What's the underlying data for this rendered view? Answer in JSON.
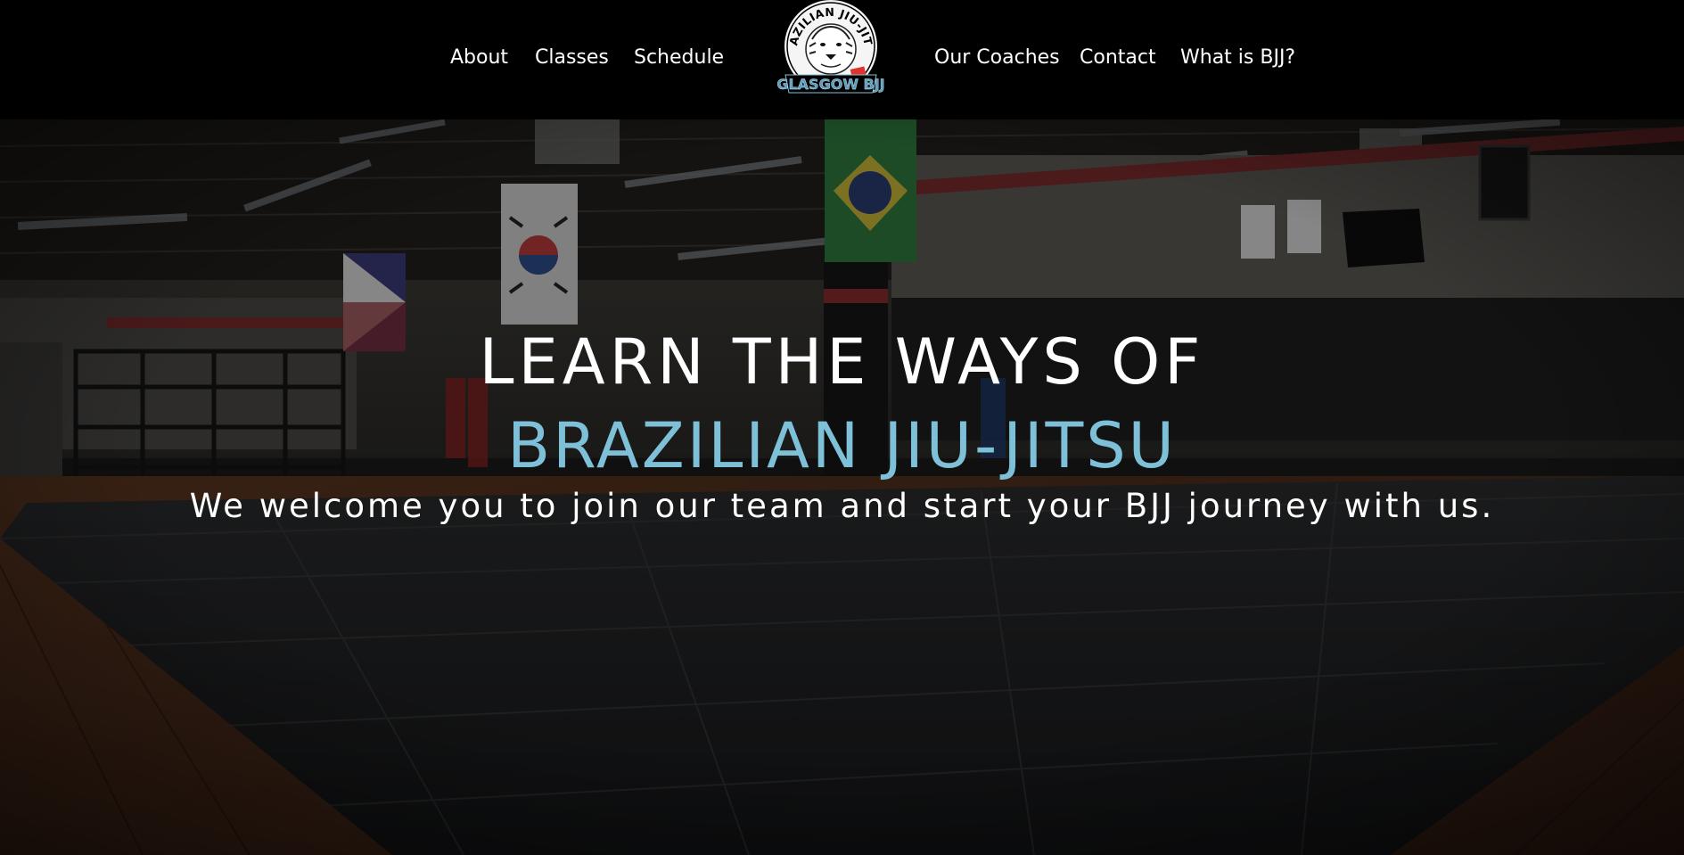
{
  "nav": {
    "items_left": [
      {
        "label": "About"
      },
      {
        "label": "Classes"
      },
      {
        "label": "Schedule"
      }
    ],
    "items_right": [
      {
        "label": "Our Coaches"
      },
      {
        "label": "Contact"
      },
      {
        "label": "What is BJJ?"
      }
    ],
    "logo": {
      "ring_text": "BRAZILIAN JIU-JITSU",
      "banner_text": "GLASGOW BJJ"
    }
  },
  "hero": {
    "line1": "LEARN THE WAYS OF",
    "line2": "BRAZILIAN JIU-JITSU",
    "tagline": "We welcome you to join our team and start your BJJ journey with us."
  },
  "colors": {
    "nav_bg": "#000000",
    "text": "#ffffff",
    "accent": "#7ec0d8",
    "mat": "#1c1d1f",
    "wood": "#4a2c1c"
  }
}
